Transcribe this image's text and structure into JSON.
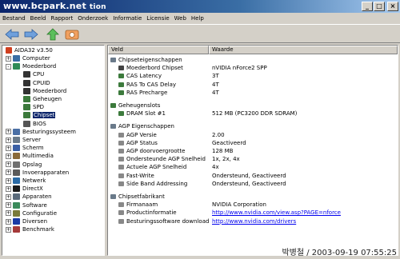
{
  "window": {
    "watermark_title": "www.bcpark.net",
    "title_suffix": "tion"
  },
  "menu": [
    {
      "label": "Bestand"
    },
    {
      "label": "Beeld"
    },
    {
      "label": "Rapport"
    },
    {
      "label": "Onderzoek"
    },
    {
      "label": "Informatie"
    },
    {
      "label": "Licensie"
    },
    {
      "label": "Web"
    },
    {
      "label": "Help"
    }
  ],
  "toolbar": [
    "back-arrow-icon",
    "forward-arrow-icon",
    "up-arrow-icon",
    "refresh-icon"
  ],
  "tree": {
    "root": "AIDA32 v3.50",
    "items": [
      {
        "label": "Computer",
        "level": 1,
        "exp": "+",
        "icon": "#3a6ea5"
      },
      {
        "label": "Moederbord",
        "level": 1,
        "exp": "-",
        "icon": "#2e8b57"
      },
      {
        "label": "CPU",
        "level": 2,
        "icon": "#333333"
      },
      {
        "label": "CPUID",
        "level": 2,
        "icon": "#333333"
      },
      {
        "label": "Moederbord",
        "level": 2,
        "icon": "#333333"
      },
      {
        "label": "Geheugen",
        "level": 2,
        "icon": "#3c7a3c"
      },
      {
        "label": "SPD",
        "level": 2,
        "icon": "#3c7a3c"
      },
      {
        "label": "Chipset",
        "level": 2,
        "icon": "#3c7a3c",
        "selected": true
      },
      {
        "label": "BIOS",
        "level": 2,
        "icon": "#555555"
      },
      {
        "label": "Besturingssysteem",
        "level": 1,
        "exp": "+",
        "icon": "#4a6fa5"
      },
      {
        "label": "Server",
        "level": 1,
        "exp": "+",
        "icon": "#6a7a8a"
      },
      {
        "label": "Scherm",
        "level": 1,
        "exp": "+",
        "icon": "#3a5fa5"
      },
      {
        "label": "Multimedia",
        "level": 1,
        "exp": "+",
        "icon": "#8a6a3a"
      },
      {
        "label": "Opslag",
        "level": 1,
        "exp": "+",
        "icon": "#707070"
      },
      {
        "label": "Invoerapparaten",
        "level": 1,
        "exp": "+",
        "icon": "#5a5a5a"
      },
      {
        "label": "Netwerk",
        "level": 1,
        "exp": "+",
        "icon": "#2a6aa5"
      },
      {
        "label": "DirectX",
        "level": 1,
        "exp": "+",
        "icon": "#1a1a1a"
      },
      {
        "label": "Apparaten",
        "level": 1,
        "exp": "+",
        "icon": "#5a6a7a"
      },
      {
        "label": "Software",
        "level": 1,
        "exp": "+",
        "icon": "#3a8a5a"
      },
      {
        "label": "Configuratie",
        "level": 1,
        "exp": "+",
        "icon": "#7a7a3a"
      },
      {
        "label": "Diversen",
        "level": 1,
        "exp": "+",
        "icon": "#1a3aa5"
      },
      {
        "label": "Benchmark",
        "level": 1,
        "exp": "+",
        "icon": "#a53a3a"
      }
    ]
  },
  "columns": {
    "field": "Veld",
    "value": "Waarde"
  },
  "rows": [
    {
      "kind": "group",
      "field": "Chipseteigenschappen",
      "icon": "#6a7a8a"
    },
    {
      "kind": "item",
      "field": "Moederbord Chipset",
      "value": "nVIDIA nForce2 SPP",
      "icon": "#444444"
    },
    {
      "kind": "item",
      "field": "CAS Latency",
      "value": "3T",
      "icon": "#3c7a3c"
    },
    {
      "kind": "item",
      "field": "RAS To CAS Delay",
      "value": "4T",
      "icon": "#3c7a3c"
    },
    {
      "kind": "item",
      "field": "RAS Precharge",
      "value": "4T",
      "icon": "#3c7a3c"
    },
    {
      "kind": "spacer"
    },
    {
      "kind": "group",
      "field": "Geheugenslots",
      "icon": "#3c7a3c"
    },
    {
      "kind": "item",
      "field": "DRAM Slot #1",
      "value": "512 MB  (PC3200 DDR SDRAM)",
      "icon": "#3c7a3c"
    },
    {
      "kind": "spacer"
    },
    {
      "kind": "group",
      "field": "AGP Eigenschappen",
      "icon": "#6a7a8a"
    },
    {
      "kind": "item",
      "field": "AGP Versie",
      "value": "2.00",
      "icon": "#888888"
    },
    {
      "kind": "item",
      "field": "AGP Status",
      "value": "Geactiveerd",
      "icon": "#888888"
    },
    {
      "kind": "item",
      "field": "AGP doorvoergrootte",
      "value": "128 MB",
      "icon": "#888888"
    },
    {
      "kind": "item",
      "field": "Ondersteunde AGP Snelheid",
      "value": "1x, 2x, 4x",
      "icon": "#888888"
    },
    {
      "kind": "item",
      "field": "Actuele AGP Snelheid",
      "value": "4x",
      "icon": "#888888"
    },
    {
      "kind": "item",
      "field": "Fast-Write",
      "value": "Ondersteund, Geactiveerd",
      "icon": "#888888"
    },
    {
      "kind": "item",
      "field": "Side Band Addressing",
      "value": "Ondersteund, Geactiveerd",
      "icon": "#888888"
    },
    {
      "kind": "spacer"
    },
    {
      "kind": "group",
      "field": "Chipsetfabrikant",
      "icon": "#6a7a8a"
    },
    {
      "kind": "item",
      "field": "Firmanaam",
      "value": "NVIDIA Corporation",
      "icon": "#888888"
    },
    {
      "kind": "item",
      "field": "Productinformatie",
      "value": "http://www.nvidia.com/view.asp?PAGE=nforce",
      "icon": "#888888",
      "link": true
    },
    {
      "kind": "item",
      "field": "Besturingssoftware download",
      "value": "http://www.nvidia.com/drivers",
      "icon": "#888888",
      "link": true
    }
  ],
  "footer_watermark": "박병철 / 2003-09-19 07:55:25"
}
